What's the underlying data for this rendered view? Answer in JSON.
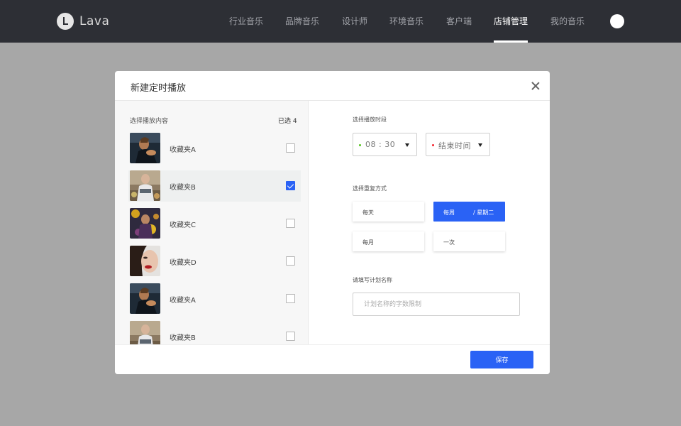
{
  "header": {
    "logo_text": "Lava",
    "nav": [
      {
        "label": "行业音乐",
        "active": false
      },
      {
        "label": "品牌音乐",
        "active": false
      },
      {
        "label": "设计师",
        "active": false
      },
      {
        "label": "环境音乐",
        "active": false
      },
      {
        "label": "客户端",
        "active": false
      },
      {
        "label": "店铺管理",
        "active": true
      },
      {
        "label": "我的音乐",
        "active": false
      }
    ]
  },
  "modal": {
    "title": "新建定时播放",
    "left": {
      "label": "选择播放内容",
      "selected_count": "已选 4",
      "items": [
        {
          "label": "收藏夹A",
          "checked": false
        },
        {
          "label": "收藏夹B",
          "checked": true
        },
        {
          "label": "收藏夹C",
          "checked": false
        },
        {
          "label": "收藏夹D",
          "checked": false
        },
        {
          "label": "收藏夹A",
          "checked": false
        },
        {
          "label": "收藏夹B",
          "checked": false
        }
      ]
    },
    "right": {
      "time_label": "选择播放时段",
      "start_time": "08 : 30",
      "end_time_placeholder": "结束时间",
      "repeat_label": "选择重复方式",
      "repeat_options": {
        "daily": "每天",
        "weekly": "每周",
        "weekly_detail": "/ 星期二",
        "monthly": "每月",
        "once": "一次"
      },
      "name_label": "请填写计划名称",
      "name_placeholder": "计划名称的字数限制"
    },
    "save_label": "保存"
  },
  "colors": {
    "accent": "#2a62f5",
    "start_dot": "#52c41a",
    "end_dot": "#f5222d",
    "topbar": "#2d2f35"
  }
}
